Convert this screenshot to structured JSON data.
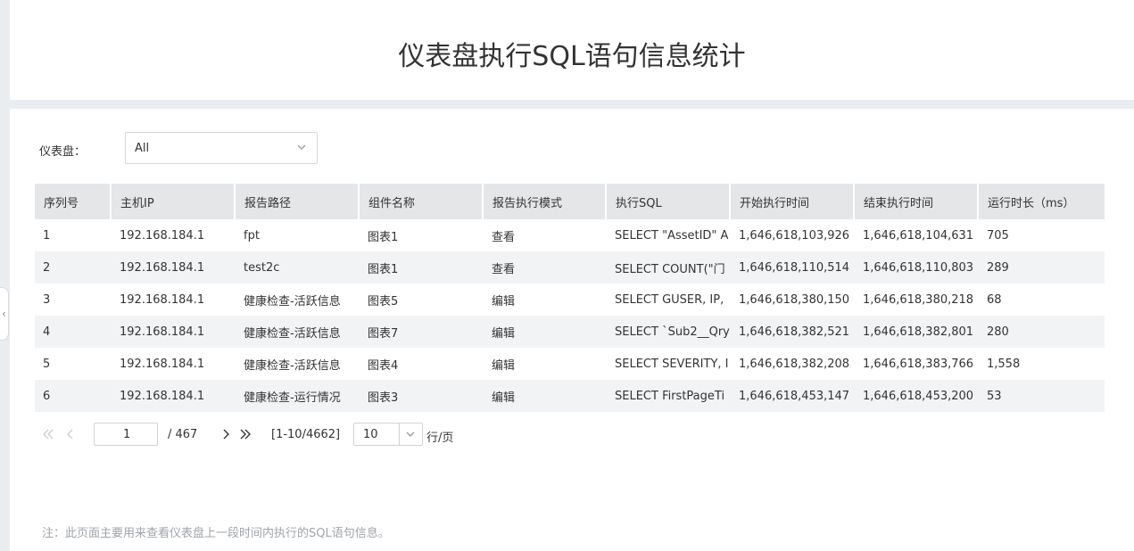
{
  "page": {
    "title": "仪表盘执行SQL语句信息统计"
  },
  "filter": {
    "label": "仪表盘：",
    "selected": "All"
  },
  "table": {
    "columns": [
      "序列号",
      "主机IP",
      "报告路径",
      "组件名称",
      "报告执行模式",
      "执行SQL",
      "开始执行时间",
      "结束执行时间",
      "运行时长（ms）"
    ],
    "rows": [
      [
        "1",
        "192.168.184.1",
        "fpt",
        "图表1",
        "查看",
        "SELECT \"AssetID\" A",
        "1,646,618,103,926",
        "1,646,618,104,631",
        "705"
      ],
      [
        "2",
        "192.168.184.1",
        "test2c",
        "图表1",
        "查看",
        "SELECT COUNT(\"门",
        "1,646,618,110,514",
        "1,646,618,110,803",
        "289"
      ],
      [
        "3",
        "192.168.184.1",
        "健康检查-活跃信息",
        "图表5",
        "编辑",
        "SELECT GUSER, IP,",
        "1,646,618,380,150",
        "1,646,618,380,218",
        "68"
      ],
      [
        "4",
        "192.168.184.1",
        "健康检查-活跃信息",
        "图表7",
        "编辑",
        "SELECT `Sub2__Qry",
        "1,646,618,382,521",
        "1,646,618,382,801",
        "280"
      ],
      [
        "5",
        "192.168.184.1",
        "健康检查-活跃信息",
        "图表4",
        "编辑",
        "SELECT SEVERITY, I",
        "1,646,618,382,208",
        "1,646,618,383,766",
        "1,558"
      ],
      [
        "6",
        "192.168.184.1",
        "健康检查-运行情况",
        "图表3",
        "编辑",
        "SELECT FirstPageTi",
        "1,646,618,453,147",
        "1,646,618,453,200",
        "53"
      ]
    ]
  },
  "pager": {
    "current_page": "1",
    "total_pages": "/ 467",
    "range": "[1-10/4662]",
    "page_size": "10",
    "per_page_label": "行/页"
  },
  "note": "注：此页面主要用来查看仪表盘上一段时间内执行的SQL语句信息。",
  "colors": {
    "header_bg": "#e4e6e8",
    "stripe_bg": "#f2f3f4",
    "page_bg": "#e9edf0"
  }
}
